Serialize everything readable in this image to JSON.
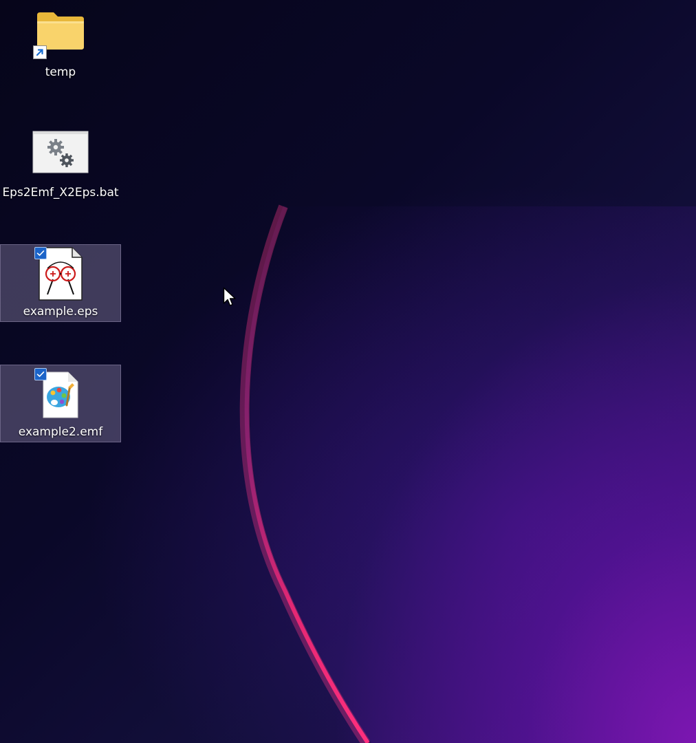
{
  "desktop": {
    "icons": [
      {
        "label": "temp",
        "icon": "folder-shortcut-icon",
        "selected": false
      },
      {
        "label": "Eps2Emf_X2Eps.bat",
        "icon": "batch-file-gears-icon",
        "selected": false
      },
      {
        "label": "example.eps",
        "icon": "eps-file-icon",
        "selected": true
      },
      {
        "label": "example2.emf",
        "icon": "emf-paint-file-icon",
        "selected": true
      }
    ]
  },
  "colors": {
    "selection_fill": "#8c82aa",
    "checkbox_blue": "#1c64c8",
    "wallpaper_dark": "#07061a",
    "wallpaper_purple": "#8a10c0",
    "arc_pink": "#ff2a78"
  }
}
